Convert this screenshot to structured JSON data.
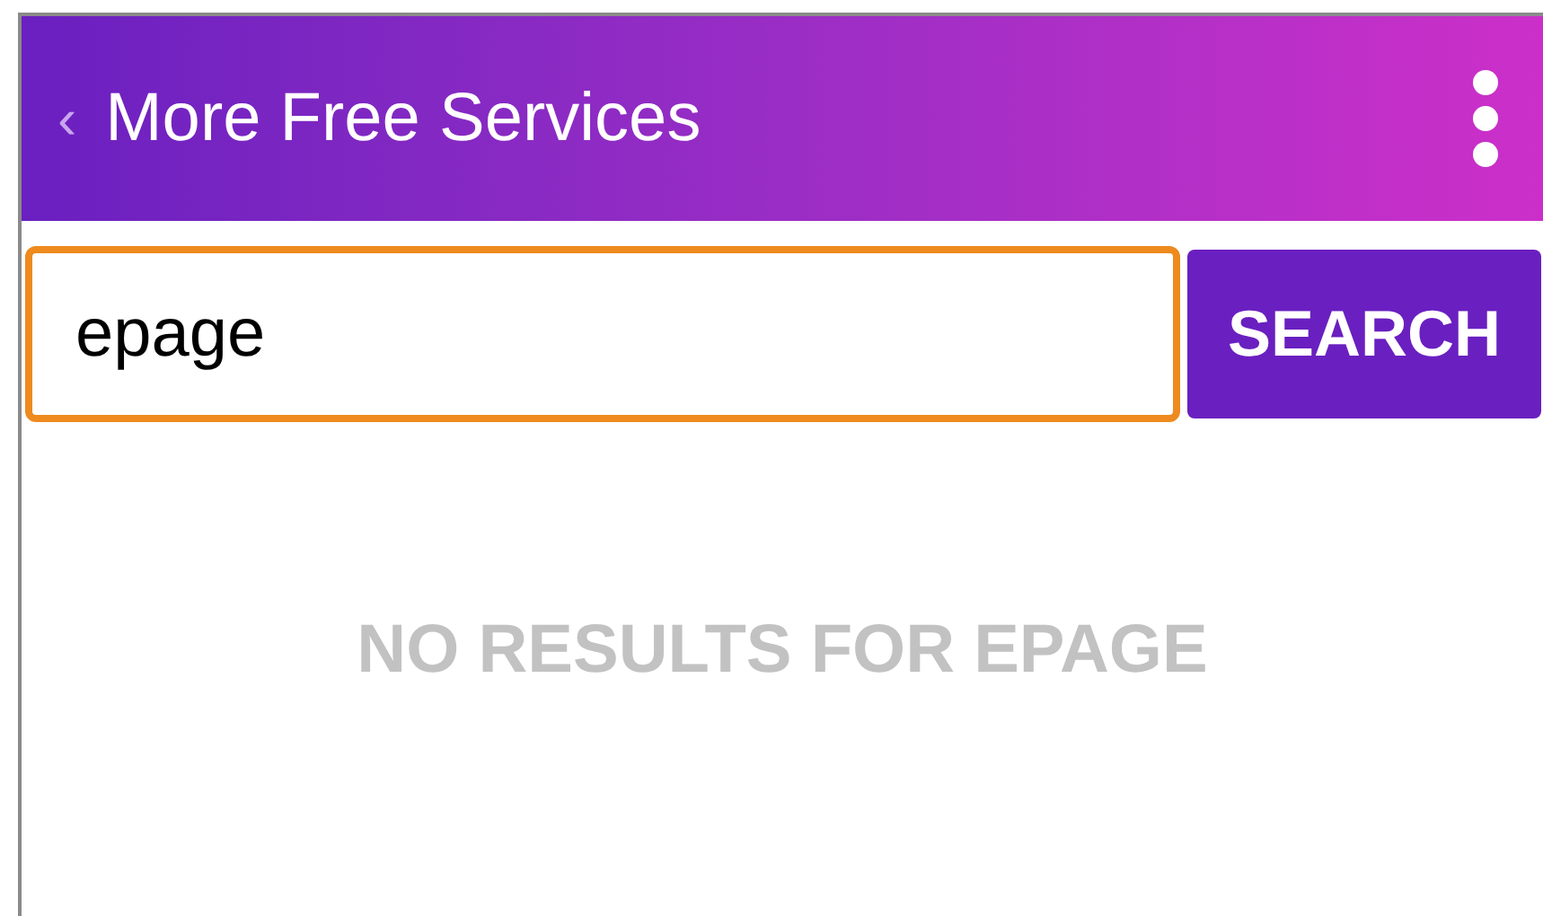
{
  "header": {
    "back": "‹",
    "title": "More Free Services"
  },
  "search": {
    "value": "epage",
    "focused": true,
    "button": "SEARCH"
  },
  "message": "NO RESULTS FOR EPAGE"
}
